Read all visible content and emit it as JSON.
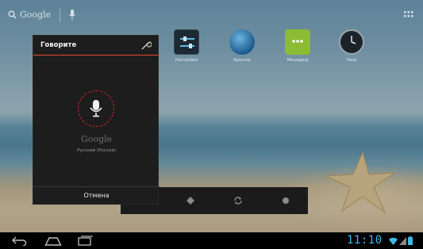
{
  "search_bar": {
    "google_label": "Google",
    "search_icon": "search-icon",
    "mic_icon": "microphone-icon",
    "apps_icon": "all-apps-grid-icon"
  },
  "shortcuts": [
    {
      "label": "Настройки",
      "icon": "settings-icon"
    },
    {
      "label": "Браузер",
      "icon": "globe-icon"
    },
    {
      "label": "Messaging",
      "icon": "message-icon"
    },
    {
      "label": "Часы",
      "icon": "clock-icon"
    }
  ],
  "voice_dialog": {
    "title": "Говорите",
    "settings_icon": "wrench-icon",
    "mic_icon": "microphone-icon",
    "brand": "Google",
    "language": "Русский (Россия)",
    "cancel_label": "Отмена",
    "accent_color": "#e14b2f"
  },
  "dock": {
    "buttons": [
      {
        "icon": "diamond-icon"
      },
      {
        "icon": "refresh-icon"
      },
      {
        "icon": "dot-icon"
      }
    ]
  },
  "navigation_bar": {
    "back_icon": "back-icon",
    "home_icon": "home-icon",
    "recent_icon": "recent-apps-icon",
    "clock": "11:10",
    "clock_color": "#3fb8e8",
    "status_icons": [
      "wifi-icon",
      "signal-icon",
      "battery-icon"
    ]
  }
}
